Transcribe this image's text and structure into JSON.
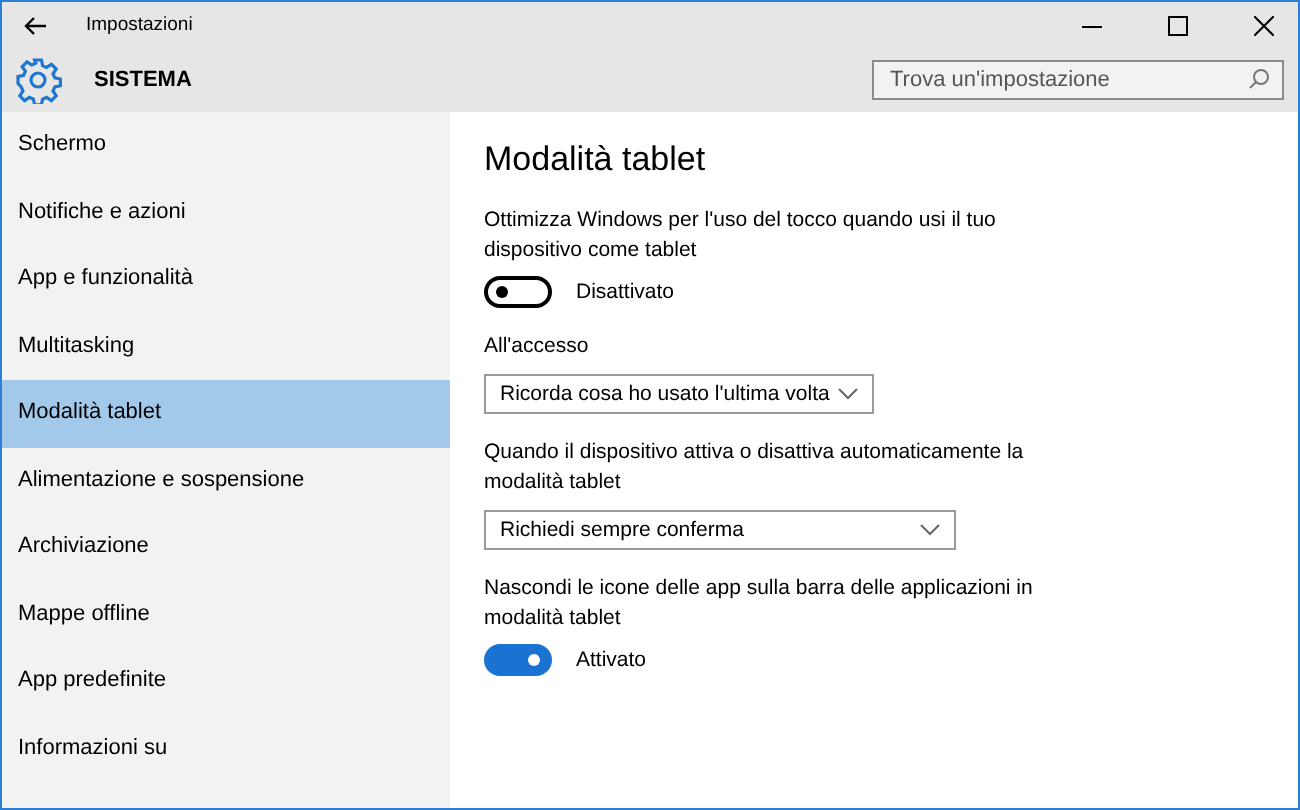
{
  "window": {
    "title": "Impostazioni"
  },
  "header": {
    "title": "SISTEMA",
    "search": {
      "placeholder": "Trova un'impostazione"
    }
  },
  "sidebar": {
    "items": [
      {
        "label": "Schermo",
        "selected": false
      },
      {
        "label": "Notifiche e azioni",
        "selected": false
      },
      {
        "label": "App e funzionalità",
        "selected": false
      },
      {
        "label": "Multitasking",
        "selected": false
      },
      {
        "label": "Modalità tablet",
        "selected": true
      },
      {
        "label": "Alimentazione e sospensione",
        "selected": false
      },
      {
        "label": "Archiviazione",
        "selected": false
      },
      {
        "label": "Mappe offline",
        "selected": false
      },
      {
        "label": "App predefinite",
        "selected": false
      },
      {
        "label": "Informazioni su",
        "selected": false
      }
    ]
  },
  "content": {
    "title": "Modalità tablet",
    "settings": [
      {
        "kind": "toggle",
        "label": "Ottimizza Windows per l'uso del tocco quando usi il tuo dispositivo come tablet",
        "on": false,
        "state_text": "Disattivato"
      },
      {
        "kind": "dropdown",
        "label": "All'accesso",
        "value": "Ricorda cosa ho usato l'ultima volta"
      },
      {
        "kind": "dropdown",
        "label": "Quando il dispositivo attiva o disattiva automaticamente la modalità tablet",
        "value": "Richiedi sempre conferma",
        "wide": true
      },
      {
        "kind": "toggle",
        "label": "Nascondi le icone delle app sulla barra delle applicazioni in modalità tablet",
        "on": true,
        "state_text": "Attivato"
      }
    ]
  }
}
